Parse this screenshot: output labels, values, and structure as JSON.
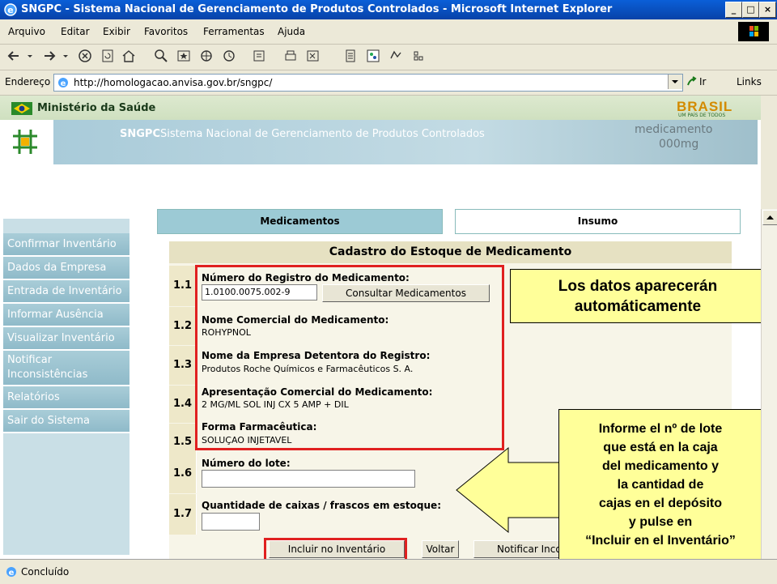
{
  "window": {
    "title": "SNGPC - Sistema Nacional de Gerenciamento de Produtos Controlados - Microsoft Internet Explorer"
  },
  "menu": [
    "Arquivo",
    "Editar",
    "Exibir",
    "Favoritos",
    "Ferramentas",
    "Ajuda"
  ],
  "address": {
    "label": "Endereço",
    "url": "http://homologacao.anvisa.gov.br/sngpc/",
    "go": "Ir",
    "links": "Links"
  },
  "header": {
    "ministry": "Ministério da Saúde",
    "brand": "SNGPC",
    "system": "Sistema Nacional de Gerenciamento de Produtos Controlados",
    "brasil": "BRASIL",
    "brasil_sub": "UM PAÍS DE TODOS",
    "med1": "medicamento",
    "med2": "000mg"
  },
  "tabs": {
    "active": "Medicamentos",
    "inactive": "Insumo"
  },
  "sidebar": [
    "Confirmar Inventário",
    "Dados da Empresa",
    "Entrada de Inventário",
    "Informar Ausência",
    "Visualizar Inventário",
    "Notificar Inconsistências",
    "Relatórios",
    "Sair do Sistema"
  ],
  "form": {
    "title": "Cadastro do Estoque de Medicamento",
    "rows": [
      {
        "num": "1.1",
        "label": "Número do Registro do Medicamento:",
        "value": "1.0100.0075.002-9"
      },
      {
        "num": "1.2",
        "label": "Nome Comercial do Medicamento:",
        "value": "ROHYPNOL"
      },
      {
        "num": "1.3",
        "label": "Nome da Empresa Detentora do Registro:",
        "value": "Produtos Roche Químicos e Farmacêuticos S. A."
      },
      {
        "num": "1.4",
        "label": "Apresentação Comercial do Medicamento:",
        "value": "2 MG/ML SOL INJ CX 5 AMP + DIL"
      },
      {
        "num": "1.5",
        "label": "Forma Farmacêutica:",
        "value": "SOLUÇAO INJETAVEL"
      },
      {
        "num": "1.6",
        "label": "Número do lote:",
        "value": ""
      },
      {
        "num": "1.7",
        "label": "Quantidade de caixas / frascos em estoque:",
        "value": ""
      }
    ],
    "consult_button": "Consultar Medicamentos",
    "include_button": "Incluir no Inventário",
    "back_button": "Voltar",
    "notify_button": "Notificar Inco"
  },
  "callouts": {
    "auto_line1": "Los datos aparecerán",
    "auto_line2": "automáticamente",
    "lot": [
      "Informe el nº de lote",
      "que está en la caja",
      "del medicamento y",
      "la cantidad de",
      "cajas en el depósito",
      "y pulse  en",
      "“Incluir en el Inventário”"
    ]
  },
  "status": {
    "text": "Concluído"
  },
  "colors": {
    "titlebar": "#0842a8",
    "sidebar": "#9cc4d1",
    "header_band": "#9cc4d3",
    "highlight": "#e02020",
    "callout": "#ffff99"
  }
}
